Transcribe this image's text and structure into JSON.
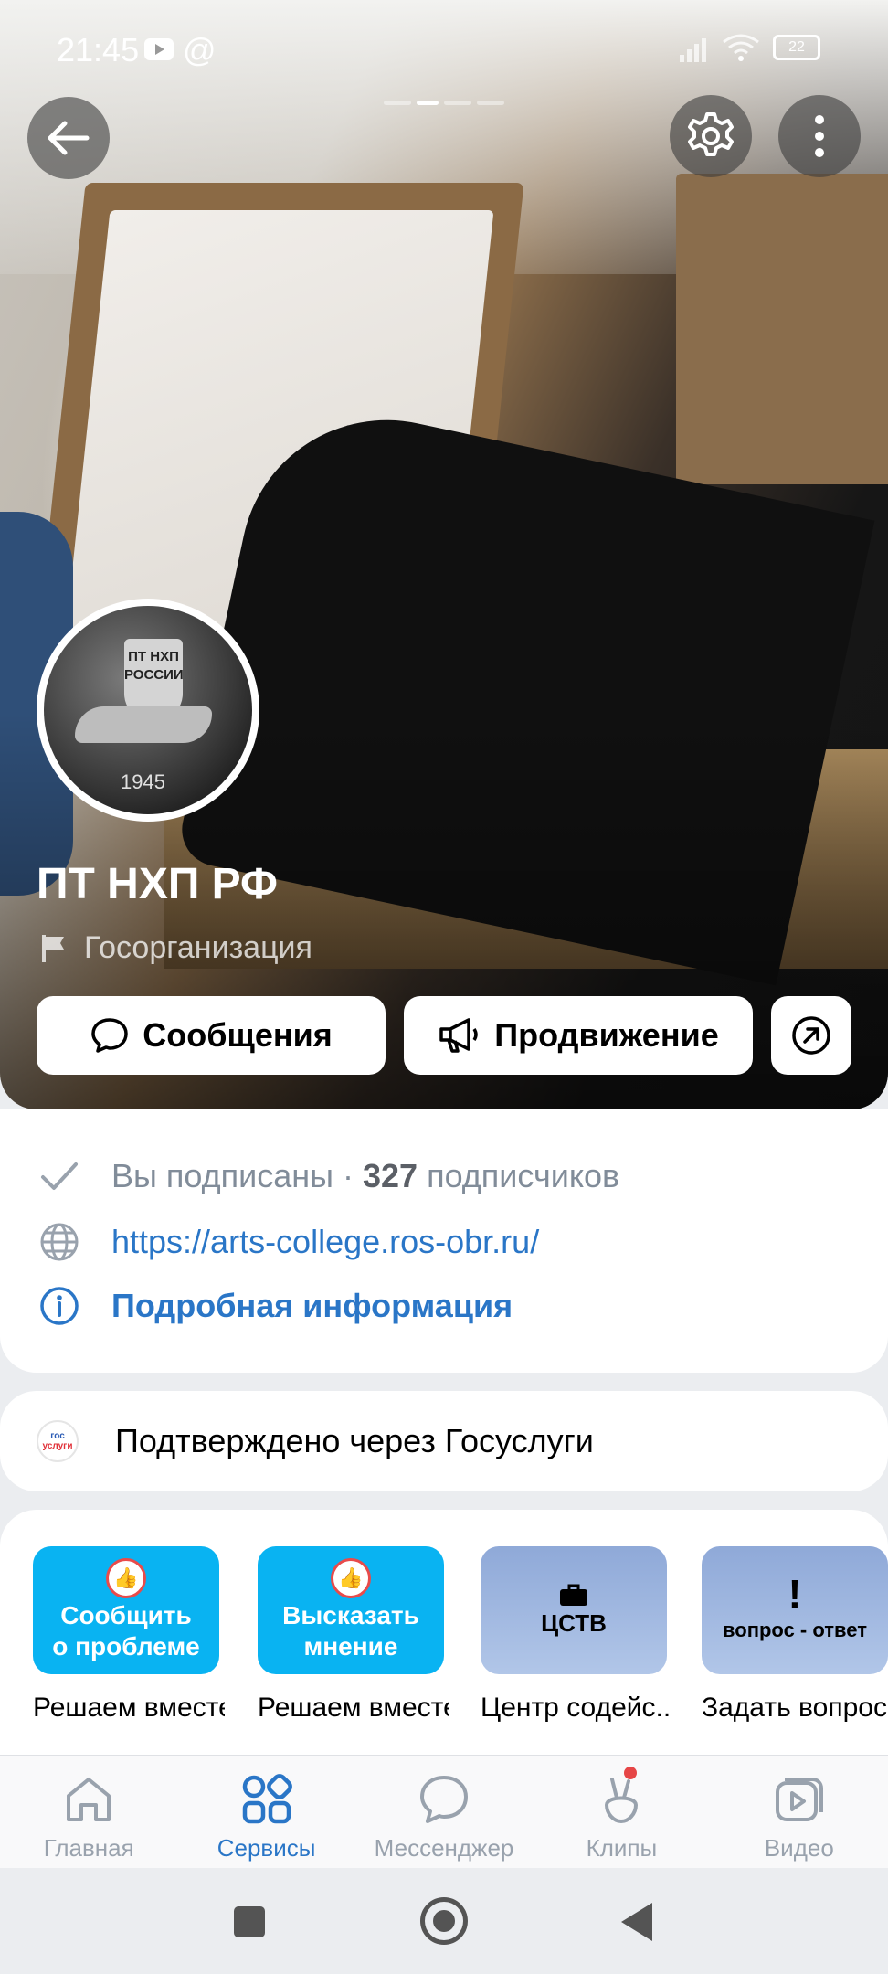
{
  "status_bar": {
    "time": "21:45",
    "at": "@",
    "battery": "22"
  },
  "group": {
    "name": "ПТ НХП РФ",
    "type": "Госорганизация",
    "avatar_text": "ПТ НХП РОССИИ",
    "avatar_year": "1945"
  },
  "actions": {
    "messages": "Сообщения",
    "promotion": "Продвижение"
  },
  "info": {
    "subscribed": "Вы подписаны",
    "separator": " · ",
    "subscribers_count": "327",
    "subscribers_label": " подписчиков",
    "link": "https://arts-college.ros-obr.ru/",
    "details": "Подробная информация"
  },
  "gosuslugi": {
    "logo_top": "гос",
    "logo_bottom": "услуги",
    "text": "Подтверждено через Госуслуги"
  },
  "services": [
    {
      "tile": "Сообщить\nо проблеме",
      "caption": "Решаем вместе"
    },
    {
      "tile": "Высказать\nмнение",
      "caption": "Решаем вместе"
    },
    {
      "tile": "ЦСТВ",
      "caption": "Центр содейс..."
    },
    {
      "tile": "вопрос - ответ",
      "caption": "Задать вопрос"
    }
  ],
  "tabs": [
    {
      "label": "Главная",
      "icon": "home-icon"
    },
    {
      "label": "Сервисы",
      "icon": "services-icon",
      "active": true
    },
    {
      "label": "Мессенджер",
      "icon": "messenger-icon"
    },
    {
      "label": "Клипы",
      "icon": "clips-icon",
      "badge": true
    },
    {
      "label": "Видео",
      "icon": "video-icon"
    }
  ],
  "colors": {
    "accent": "#2a76c7",
    "tile_blue": "#09b3f2",
    "badge": "#e64646"
  }
}
